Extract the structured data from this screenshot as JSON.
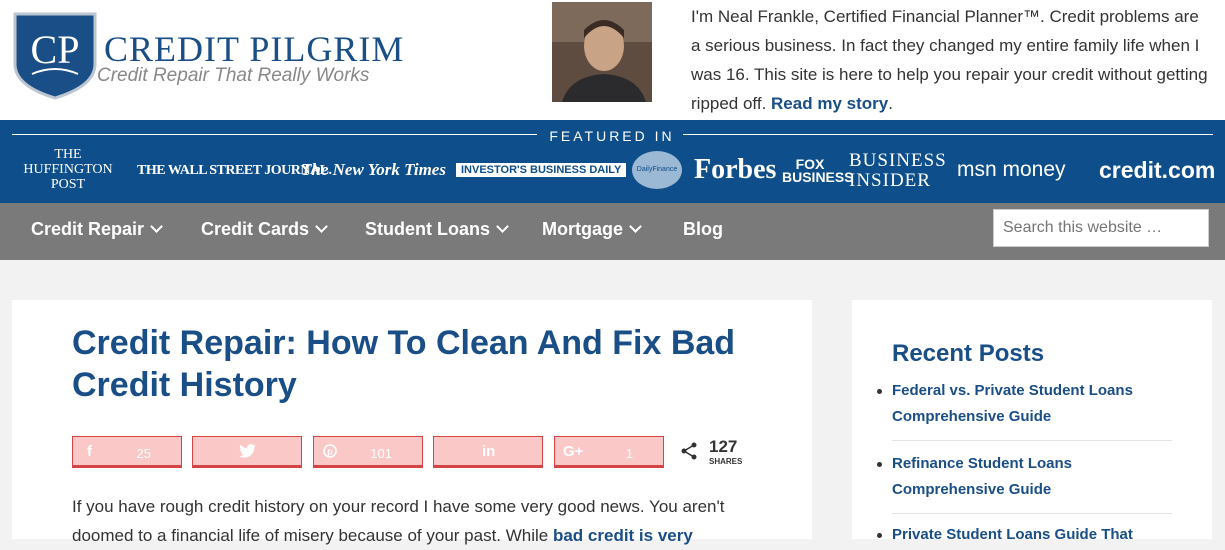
{
  "header": {
    "logo_initials": "CP",
    "logo_title": "CREDIT PILGRIM",
    "logo_tagline": "Credit Repair That Really Works",
    "intro_text": "I'm Neal Frankle, Certified Financial Planner™. Credit problems are a serious business. In fact they changed my entire family life when I was 16. This site is here to help you repair your credit without getting ripped off.",
    "intro_link": "Read my story",
    "intro_end": "."
  },
  "featured": {
    "label": "FEATURED IN",
    "publications": [
      "THE HUFFINGTON POST",
      "THE WALL STREET JOURNAL.",
      "The New York Times",
      "INVESTOR'S BUSINESS DAILY",
      "DailyFinance",
      "Forbes",
      "FOX BUSINESS",
      "BUSINESS INSIDER",
      "msn money",
      "credit.com"
    ]
  },
  "nav": {
    "items": [
      "Credit Repair",
      "Credit Cards",
      "Student Loans",
      "Mortgage",
      "Blog"
    ],
    "search_placeholder": "Search this website …"
  },
  "article": {
    "title": "Credit Repair: How To Clean And Fix Bad Credit History",
    "share_buttons": [
      {
        "network": "facebook",
        "icon": "f",
        "count": "25"
      },
      {
        "network": "twitter",
        "icon": "twitter-bird",
        "count": ""
      },
      {
        "network": "pinterest",
        "icon": "pinterest",
        "count": "101"
      },
      {
        "network": "linkedin",
        "icon": "in",
        "count": ""
      },
      {
        "network": "googleplus",
        "icon": "G+",
        "count": "1"
      }
    ],
    "share_total": "127",
    "share_label": "SHARES",
    "body_text": "If you have rough credit history on your record I have some very good news. You aren't doomed to a financial life of misery because of your past. While ",
    "body_link": "bad credit is very"
  },
  "sidebar": {
    "heading": "Recent Posts",
    "posts": [
      "Federal vs. Private Student Loans Comprehensive Guide",
      "Refinance Student Loans Comprehensive Guide",
      "Private Student Loans Guide That"
    ]
  },
  "colors": {
    "brand_blue": "#1a4e86",
    "featured_bg": "#0e4e8a",
    "nav_bg": "#7a7a7a",
    "share_btn_bg": "#fbc8c8"
  }
}
